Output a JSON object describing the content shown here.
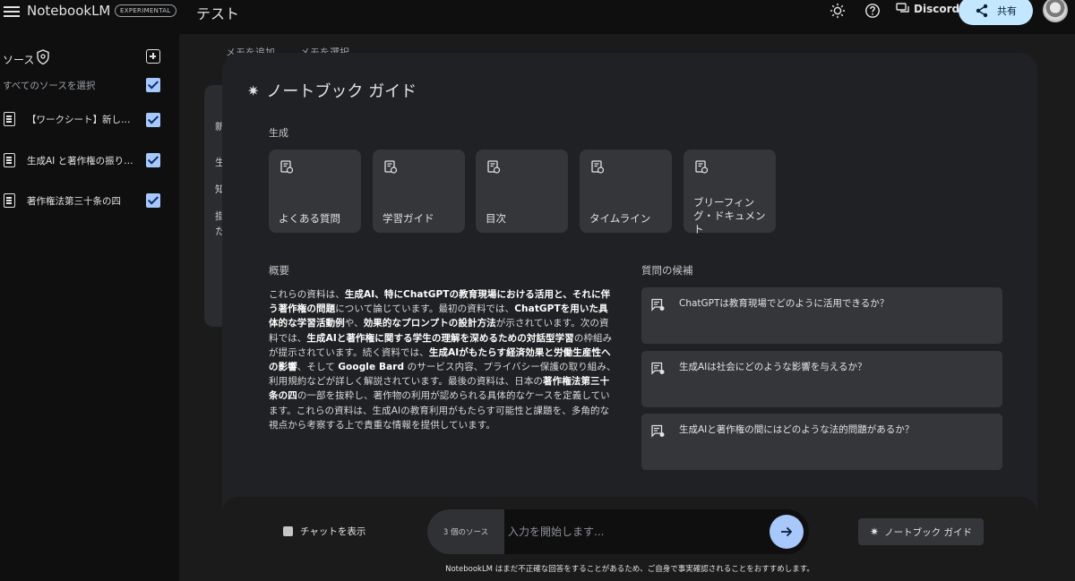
{
  "app": {
    "name": "NotebookLM",
    "badge": "EXPERIMENTAL",
    "notebook_title": "テスト"
  },
  "header": {
    "discord_label": "Discord",
    "share_label": "共有"
  },
  "sidebar": {
    "heading": "ソース",
    "select_all": "すべてのソースを選択",
    "items": [
      {
        "label": "【ワークシート】新し…",
        "checked": true
      },
      {
        "label": "生成AI と著作権の振り…",
        "checked": true
      },
      {
        "label": "著作権法第三十条の四",
        "checked": true
      }
    ]
  },
  "background": {
    "tabs": [
      "メモを追加",
      "メモを選択"
    ],
    "card_lines": [
      "新",
      "生",
      "知",
      "掛",
      "た"
    ]
  },
  "guide": {
    "title": "ノートブック ガイド",
    "generate_label": "生成",
    "generate_items": [
      "よくある質問",
      "学習ガイド",
      "目次",
      "タイムライン",
      "ブリーフィング・ドキュメント"
    ],
    "summary_title": "概要",
    "summary_segments": [
      {
        "t": "これらの資料は、",
        "b": false
      },
      {
        "t": "生成AI、特にChatGPTの教育現場における活用と、それに伴う著作権の問題",
        "b": true
      },
      {
        "t": "について論じています。最初の資料では、",
        "b": false
      },
      {
        "t": "ChatGPTを用いた具体的な学習活動例",
        "b": true
      },
      {
        "t": "や、",
        "b": false
      },
      {
        "t": "効果的なプロンプトの設計方法",
        "b": true
      },
      {
        "t": "が示されています。次の資料では、",
        "b": false
      },
      {
        "t": "生成AIと著作権に関する学生の理解を深めるための対話型学習",
        "b": true
      },
      {
        "t": "の枠組みが提示されています。続く資料では、",
        "b": false
      },
      {
        "t": "生成AIがもたらす経済効果と労働生産性への影響",
        "b": true
      },
      {
        "t": "、そして ",
        "b": false
      },
      {
        "t": "Google Bard",
        "b": true
      },
      {
        "t": " のサービス内容、プライバシー保護の取り組み、利用規約などが詳しく解説されています。最後の資料は、日本の",
        "b": false
      },
      {
        "t": "著作権法第三十条の四",
        "b": true
      },
      {
        "t": "の一部を抜粋し、著作物の利用が認められる具体的なケースを定義しています。これらの資料は、生成AIの教育利用がもたらす可能性と課題を、多角的な視点から考察する上で貴重な情報を提供しています。",
        "b": false
      }
    ],
    "questions_title": "質問の候補",
    "questions": [
      "ChatGPTは教育現場でどのように活用できるか？",
      "生成AIは社会にどのような影響を与えるか？",
      "生成AIと著作権の間にはどのような法的問題があるか？"
    ]
  },
  "chat": {
    "show_chat_label": "チャットを表示",
    "source_count": "3 個のソース",
    "input_placeholder": "入力を開始します...",
    "guide_button_label": "ノートブック ガイド",
    "disclaimer": "NotebookLM はまだ不正確な回答をすることがあるため、ご自身で事実確認されることをおすすめします。"
  },
  "colors": {
    "accent": "#a8c7fa",
    "share_bg": "#c2e7ff",
    "modal_bg": "#202124",
    "card_bg": "#35363a"
  }
}
